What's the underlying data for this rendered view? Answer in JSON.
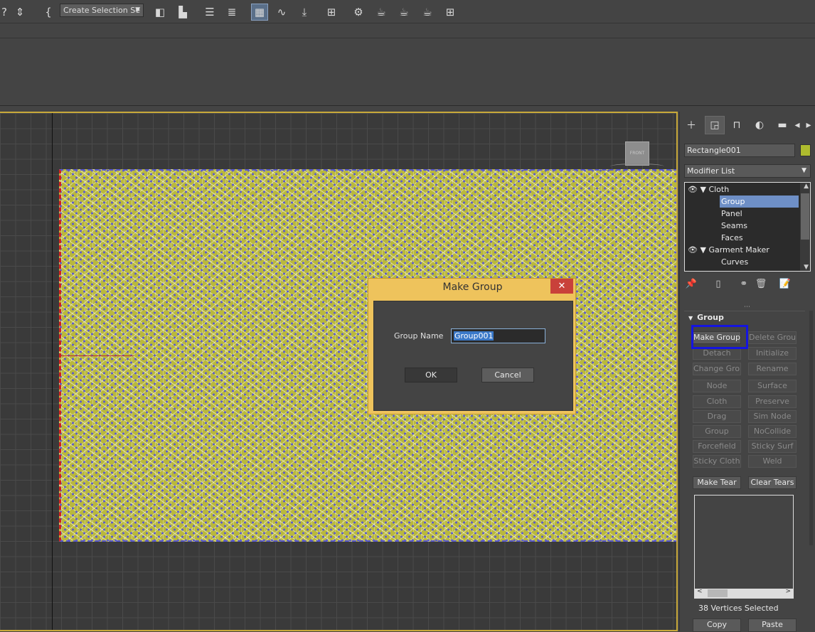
{
  "toolbar": {
    "selection_set": "Create Selection Se",
    "icons": [
      "help-icon",
      "snap-icon",
      "mirror-icon",
      "align-icon",
      "layer-explorer-icon",
      "scene-explorer-icon",
      "ribbon-icon",
      "curve-editor-icon",
      "schematic-icon",
      "material-editor-icon",
      "render-setup-icon",
      "render-frame-icon",
      "render-icon",
      "render-cloud-icon",
      "a360-icon"
    ]
  },
  "viewport": {
    "viewcube_label": "FRONT"
  },
  "dialog": {
    "title": "Make Group",
    "close": "✕",
    "field_label": "Group Name",
    "field_value": "Group001",
    "ok_label": "OK",
    "cancel_label": "Cancel"
  },
  "panel": {
    "object_name": "Rectangle001",
    "object_color": "#aebb2e",
    "modifier_list": "Modifier List",
    "stack": [
      {
        "label": "Cloth",
        "level": 0,
        "eye": true,
        "expanded": true,
        "selected": false
      },
      {
        "label": "Group",
        "level": 1,
        "eye": false,
        "expanded": false,
        "selected": true
      },
      {
        "label": "Panel",
        "level": 1,
        "eye": false,
        "expanded": false,
        "selected": false
      },
      {
        "label": "Seams",
        "level": 1,
        "eye": false,
        "expanded": false,
        "selected": false
      },
      {
        "label": "Faces",
        "level": 1,
        "eye": false,
        "expanded": false,
        "selected": false
      },
      {
        "label": "Garment Maker",
        "level": 0,
        "eye": true,
        "expanded": true,
        "selected": false
      },
      {
        "label": "Curves",
        "level": 1,
        "eye": false,
        "expanded": false,
        "selected": false
      }
    ],
    "rollout_title": "Group",
    "group_buttons": [
      {
        "label": "Make Group",
        "enabled": true
      },
      {
        "label": "Delete Group",
        "enabled": false
      },
      {
        "label": "Detach",
        "enabled": false
      },
      {
        "label": "Initialize",
        "enabled": false
      },
      {
        "label": "Change Group",
        "enabled": false
      },
      {
        "label": "Rename",
        "enabled": false
      },
      {
        "label": "Node",
        "enabled": false
      },
      {
        "label": "Surface",
        "enabled": false
      },
      {
        "label": "Cloth",
        "enabled": false
      },
      {
        "label": "Preserve",
        "enabled": false
      },
      {
        "label": "Drag",
        "enabled": false
      },
      {
        "label": "Sim Node",
        "enabled": false
      },
      {
        "label": "Group",
        "enabled": false
      },
      {
        "label": "NoCollide",
        "enabled": false
      },
      {
        "label": "Forcefield",
        "enabled": false
      },
      {
        "label": "Sticky Surf",
        "enabled": false
      },
      {
        "label": "Sticky Cloth",
        "enabled": false
      },
      {
        "label": "Weld",
        "enabled": false
      }
    ],
    "tear_buttons": [
      "Make Tear",
      "Clear Tears"
    ],
    "status": "38 Vertices Selected",
    "bottom_buttons": [
      "Copy",
      "Paste"
    ]
  }
}
